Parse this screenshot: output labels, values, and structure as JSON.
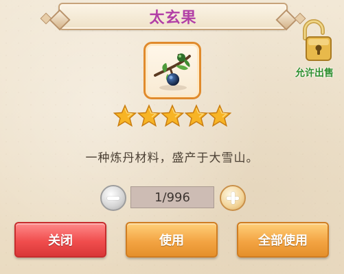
{
  "title": "太玄果",
  "lock": {
    "icon": "unlocked-padlock-icon",
    "label": "允许出售"
  },
  "item": {
    "icon": "fruit-branch-icon",
    "rarity_stars": 5
  },
  "description": "一种炼丹材料，盛产于大雪山。",
  "quantity": {
    "display": "1/996",
    "current": 1,
    "max": 996,
    "minus_icon": "minus-icon",
    "plus_icon": "plus-icon"
  },
  "buttons": {
    "close_label": "关闭",
    "use_label": "使用",
    "use_all_label": "全部使用"
  },
  "colors": {
    "title": "#b23fa6",
    "allow_sale": "#2f8f2f",
    "close_button": "#f04d4d",
    "use_button": "#f3a443",
    "item_frame": "#e08a2c"
  }
}
